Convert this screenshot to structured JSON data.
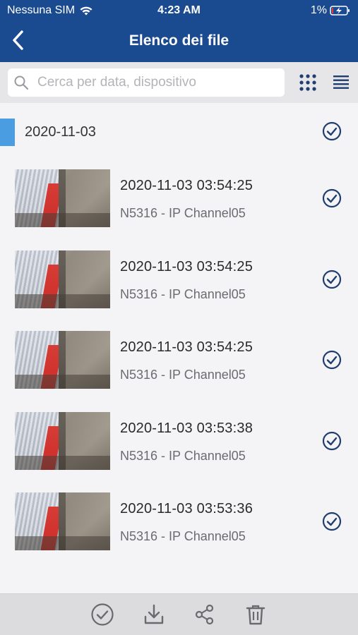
{
  "status_bar": {
    "carrier": "Nessuna SIM",
    "time": "4:23 AM",
    "battery": "1%"
  },
  "header": {
    "title": "Elenco dei file",
    "background_color": "#1a4a8f"
  },
  "search": {
    "placeholder": "Cerca per data, dispositivo",
    "value": ""
  },
  "view_toggle": {
    "grid_icon": "grid-icon",
    "list_icon": "list-icon"
  },
  "group": {
    "date": "2020-11-03",
    "marker_color": "#4a9de0"
  },
  "files": [
    {
      "time": "2020-11-03 03:54:25",
      "device": "N5316 - IP Channel05"
    },
    {
      "time": "2020-11-03 03:54:25",
      "device": "N5316 - IP Channel05"
    },
    {
      "time": "2020-11-03 03:54:25",
      "device": "N5316 - IP Channel05"
    },
    {
      "time": "2020-11-03 03:53:38",
      "device": "N5316 - IP Channel05"
    },
    {
      "time": "2020-11-03 03:53:36",
      "device": "N5316 - IP Channel05"
    }
  ],
  "bottom_bar": {
    "actions": [
      "select-all-icon",
      "download-icon",
      "share-icon",
      "trash-icon"
    ]
  },
  "colors": {
    "accent": "#1a4a8f",
    "icon": "#1a4a8f",
    "toolbar_icon": "#6a6a6e"
  }
}
